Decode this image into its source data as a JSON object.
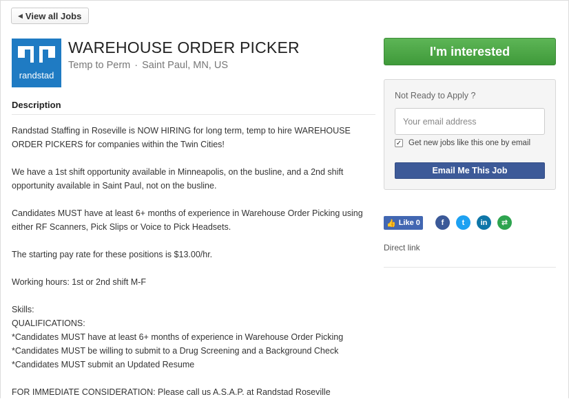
{
  "nav": {
    "back_label": "View all Jobs"
  },
  "job": {
    "company_logo_text": "randstad",
    "title": "WAREHOUSE ORDER PICKER",
    "type": "Temp to Perm",
    "separator": "·",
    "location": "Saint Paul, MN, US"
  },
  "description": {
    "heading": "Description",
    "paragraphs": [
      "Randstad Staffing in Roseville is NOW HIRING for long term, temp to hire WAREHOUSE ORDER PICKERS for companies within the Twin Cities!",
      "We have a 1st shift opportunity available in Minneapolis, on the busline, and a 2nd shift opportunity available in Saint Paul, not on the busline.",
      "Candidates MUST have at least 6+ months of experience in Warehouse Order Picking using either RF Scanners, Pick Slips or Voice to Pick Headsets.",
      "The starting pay rate for these positions is $13.00/hr.",
      "Working hours: 1st or 2nd shift M-F"
    ],
    "skills_label": "Skills:",
    "qualifications_label": "QUALIFICATIONS:",
    "qualifications": [
      "*Candidates MUST have at least 6+ months of experience in Warehouse Order Picking",
      "*Candidates MUST be willing to submit to a Drug Screening and a Background Check",
      "*Candidates MUST submit an Updated Resume"
    ],
    "closing": "FOR IMMEDIATE CONSIDERATION: Please call us A.S.A.P. at Randstad Roseville"
  },
  "sidebar": {
    "interested_label": "I'm interested",
    "apply_prompt": "Not Ready to Apply ?",
    "email_placeholder": "Your email address",
    "get_jobs_label": "Get new jobs like this one by email",
    "get_jobs_checked": true,
    "email_button": "Email Me This Job",
    "like_label": "Like 0",
    "share_icons": [
      "facebook-icon",
      "twitter-icon",
      "linkedin-icon",
      "share-icon"
    ],
    "direct_link": "Direct link"
  },
  "colors": {
    "brand_blue": "#1f7bc3",
    "interested_green": "#4caa45",
    "email_button_blue": "#3d5a98",
    "facebook": "#3b5998",
    "twitter": "#1da1f2",
    "linkedin": "#0e76a8",
    "share_green": "#2ea44f"
  }
}
